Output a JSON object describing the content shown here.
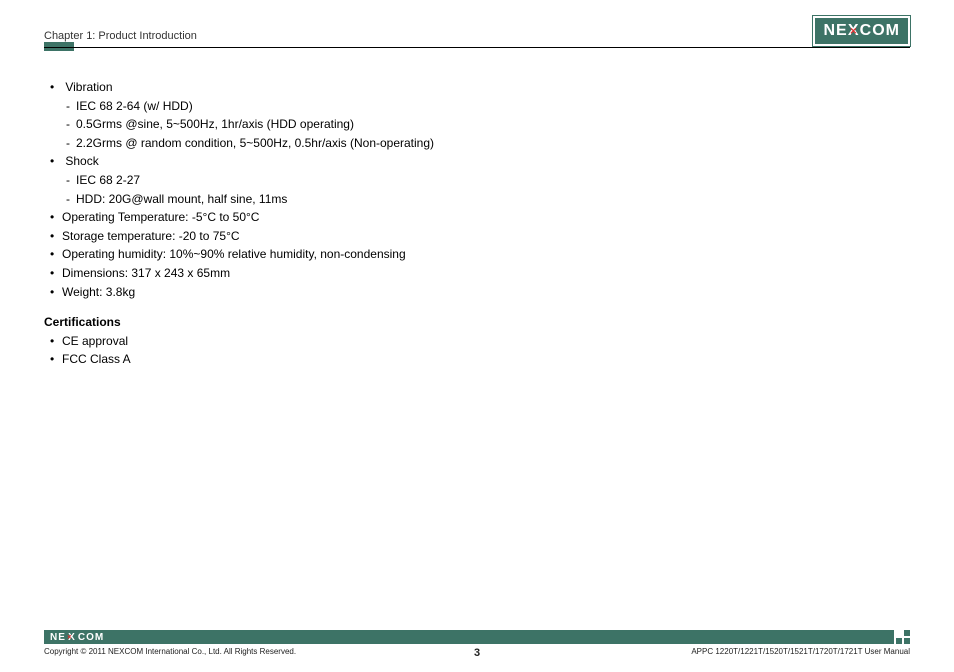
{
  "header": {
    "chapter": "Chapter 1: Product Introduction",
    "logo_text_left": "NE",
    "logo_text_right": "COM"
  },
  "specs": {
    "vibration": {
      "label": "Vibration",
      "items": [
        "IEC 68 2-64 (w/ HDD)",
        "0.5Grms @sine, 5~500Hz, 1hr/axis (HDD operating)",
        "2.2Grms @ random condition, 5~500Hz, 0.5hr/axis (Non-operating)"
      ]
    },
    "shock": {
      "label": "Shock",
      "items": [
        "IEC 68 2-27",
        "HDD: 20G@wall mount, half sine, 11ms"
      ]
    },
    "operating_temp": "Operating Temperature: -5°C to 50°C",
    "storage_temp": "Storage temperature: -20 to 75°C",
    "operating_humidity": "Operating humidity: 10%~90% relative humidity, non-condensing",
    "dimensions": "Dimensions: 317 x 243 x 65mm",
    "weight": "Weight: 3.8kg"
  },
  "certifications": {
    "heading": "Certifications",
    "items": [
      "CE approval",
      "FCC Class A"
    ]
  },
  "footer": {
    "logo_text_left": "NE",
    "logo_text_right": "COM",
    "copyright": "Copyright © 2011 NEXCOM International Co., Ltd. All Rights Reserved.",
    "page": "3",
    "manual": "APPC 1220T/1221T/1520T/1521T/1720T/1721T User Manual"
  }
}
